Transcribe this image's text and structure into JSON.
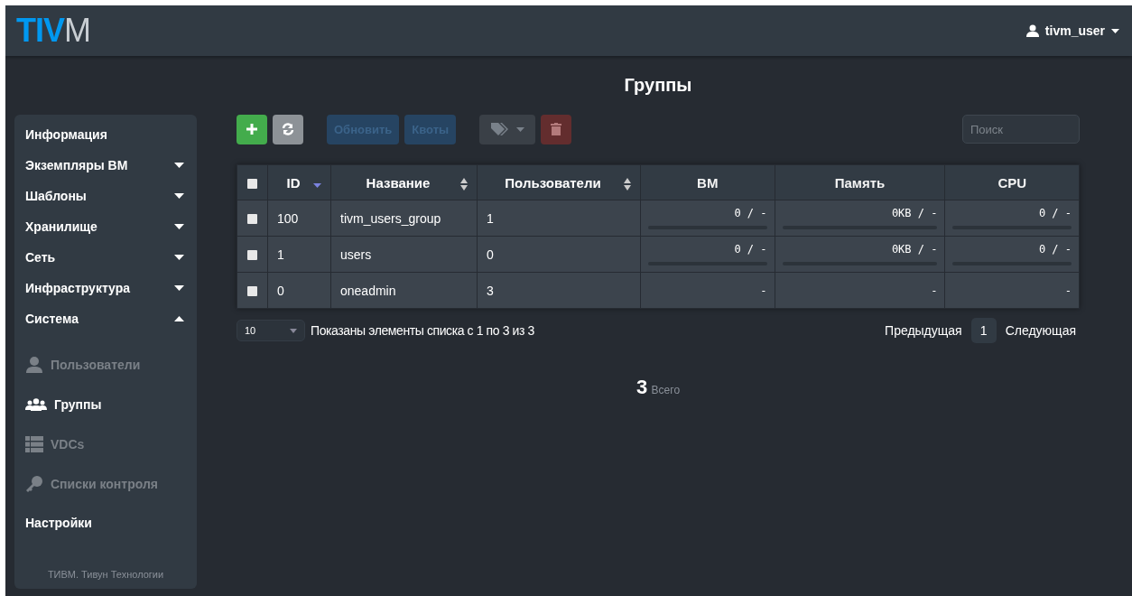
{
  "logo": {
    "bold": "TIV",
    "light": "M"
  },
  "user_menu": {
    "label": "tivm_user"
  },
  "sidebar": {
    "items": [
      {
        "label": "Информация",
        "kind": "link"
      },
      {
        "label": "Экземпляры ВМ",
        "kind": "menu",
        "expanded": false
      },
      {
        "label": "Шаблоны",
        "kind": "menu",
        "expanded": false
      },
      {
        "label": "Хранилище",
        "kind": "menu",
        "expanded": false
      },
      {
        "label": "Сеть",
        "kind": "menu",
        "expanded": false
      },
      {
        "label": "Инфраструктура",
        "kind": "menu",
        "expanded": false
      },
      {
        "label": "Система",
        "kind": "menu",
        "expanded": true,
        "children": [
          {
            "label": "Пользователи",
            "selected": false
          },
          {
            "label": "Группы",
            "selected": true
          },
          {
            "label": "VDCs",
            "selected": false
          },
          {
            "label": "Списки контроля",
            "selected": false
          }
        ]
      },
      {
        "label": "Настройки",
        "kind": "link"
      }
    ],
    "footer": "ТИВМ. Тивун Технологии"
  },
  "page_title": "Группы",
  "toolbar": {
    "buttons": [
      {
        "kind": "add",
        "disabled": false
      },
      {
        "kind": "refresh",
        "disabled": false
      },
      {
        "kind": "text",
        "label": "Обновить",
        "disabled": true
      },
      {
        "kind": "text",
        "label": "Квоты",
        "disabled": true
      },
      {
        "kind": "labels",
        "disabled": true
      },
      {
        "kind": "delete",
        "disabled": true
      }
    ],
    "search": {
      "placeholder": "Поиск"
    }
  },
  "table": {
    "select_all": {
      "checked": false
    },
    "columns": [
      {
        "label": "ID",
        "sortable": true,
        "sorted": true
      },
      {
        "label": "Название",
        "sortable": true,
        "sorted": false
      },
      {
        "label": "Пользователи",
        "sortable": true,
        "sorted": false
      },
      {
        "label": "ВМ",
        "sortable": false,
        "sorted": false
      },
      {
        "label": "Память",
        "sortable": false,
        "sorted": false
      },
      {
        "label": "CPU",
        "sortable": false,
        "sorted": false
      }
    ],
    "rows": [
      {
        "checked": false,
        "id": "100",
        "name": "tivm_users_group",
        "users": "1",
        "quotas": [
          {
            "reading": "0 / -",
            "level": 0
          },
          {
            "reading": "0KB / -",
            "level": 0
          },
          {
            "reading": "0 / -",
            "level": 0
          }
        ]
      },
      {
        "checked": false,
        "id": "1",
        "name": "users",
        "users": "0",
        "quotas": [
          {
            "reading": "0 / -",
            "level": 0
          },
          {
            "reading": "0KB / -",
            "level": 0
          },
          {
            "reading": "0 / -",
            "level": 0
          }
        ]
      },
      {
        "checked": false,
        "id": "0",
        "name": "oneadmin",
        "users": "3",
        "quotas": [
          {
            "reading": "-"
          },
          {
            "reading": "-"
          },
          {
            "reading": "-"
          }
        ]
      }
    ]
  },
  "pagination": {
    "page_size": "10",
    "info": "Показаны элементы списка с 1 по 3 из 3",
    "previous": "Предыдущая",
    "pages": [
      {
        "label": "1",
        "selected": true
      }
    ],
    "next": "Следующая"
  },
  "total": {
    "count": "3",
    "label": "Всего"
  }
}
